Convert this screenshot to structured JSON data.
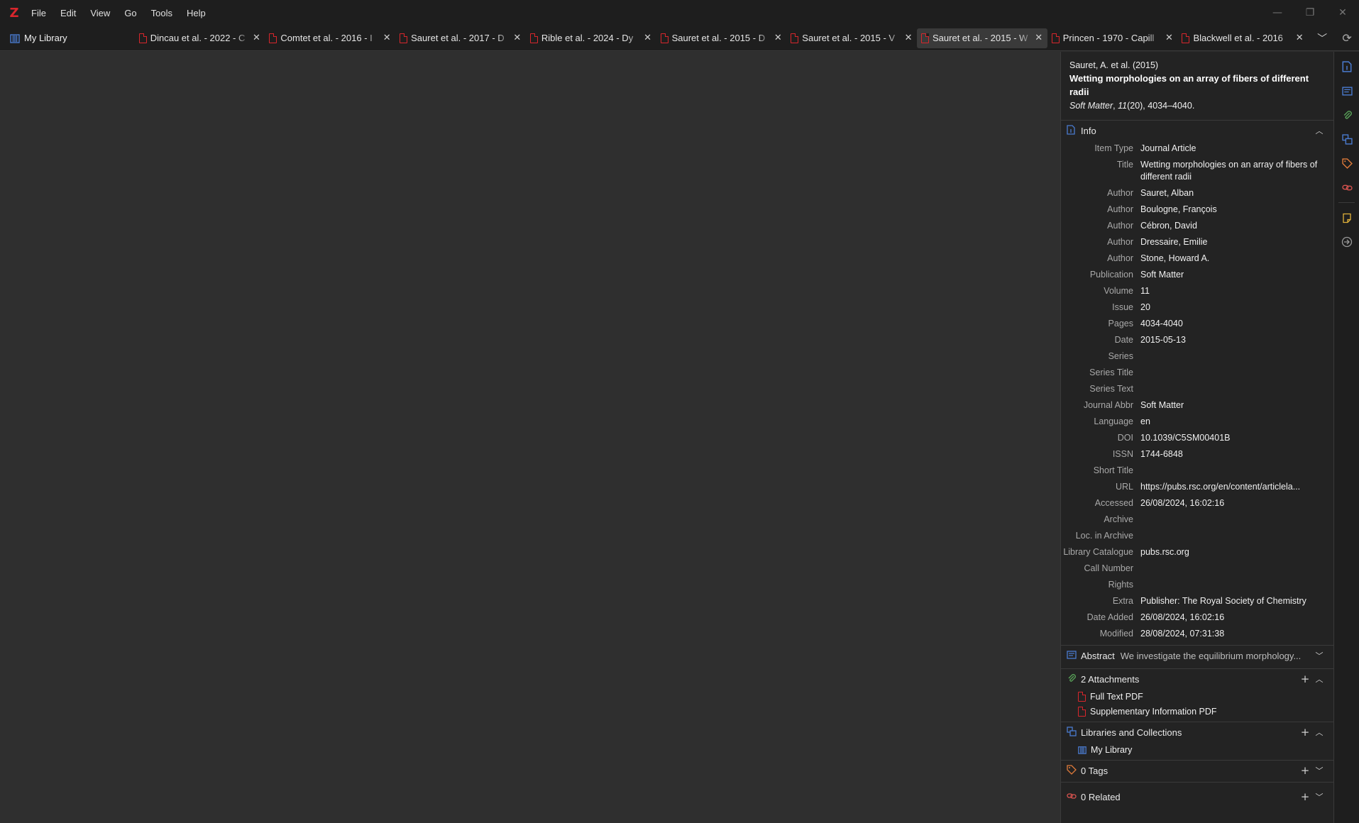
{
  "app": {
    "logo": "Z"
  },
  "menu": [
    "File",
    "Edit",
    "View",
    "Go",
    "Tools",
    "Help"
  ],
  "window_controls": {
    "minimize": "—",
    "restore": "❐",
    "close": "✕"
  },
  "library_tab": {
    "label": "My Library"
  },
  "tabs": [
    {
      "title": "Dincau et al. - 2022 - C"
    },
    {
      "title": "Comtet et al. - 2016 - I"
    },
    {
      "title": "Sauret et al. - 2017 - D"
    },
    {
      "title": "Rible et al. - 2024 - Dy"
    },
    {
      "title": "Sauret et al. - 2015 - D"
    },
    {
      "title": "Sauret et al. - 2015 - V"
    },
    {
      "title": "Sauret et al. - 2015 - W"
    },
    {
      "title": "Princen - 1970 - Capill"
    },
    {
      "title": "Blackwell et al. - 2016"
    }
  ],
  "header": {
    "cite": "Sauret, A. et al. (2015)",
    "title": "Wetting morphologies on an array of fibers of different radii",
    "journal_name": "Soft Matter",
    "journal_sep": ", ",
    "volume": "11",
    "issue_pages": "(20), 4034–4040."
  },
  "info": {
    "label": "Info",
    "fields": [
      {
        "label": "Item Type",
        "value": "Journal Article"
      },
      {
        "label": "Title",
        "value": "Wetting morphologies on an array of fibers of different radii"
      },
      {
        "label": "Author",
        "value": "Sauret, Alban"
      },
      {
        "label": "Author",
        "value": "Boulogne, François"
      },
      {
        "label": "Author",
        "value": "Cébron, David"
      },
      {
        "label": "Author",
        "value": "Dressaire, Emilie"
      },
      {
        "label": "Author",
        "value": "Stone, Howard A."
      },
      {
        "label": "Publication",
        "value": "Soft Matter"
      },
      {
        "label": "Volume",
        "value": "11"
      },
      {
        "label": "Issue",
        "value": "20"
      },
      {
        "label": "Pages",
        "value": "4034-4040"
      },
      {
        "label": "Date",
        "value": "2015-05-13"
      },
      {
        "label": "Series",
        "value": ""
      },
      {
        "label": "Series Title",
        "value": ""
      },
      {
        "label": "Series Text",
        "value": ""
      },
      {
        "label": "Journal Abbr",
        "value": "Soft Matter"
      },
      {
        "label": "Language",
        "value": "en"
      },
      {
        "label": "DOI",
        "value": "10.1039/C5SM00401B"
      },
      {
        "label": "ISSN",
        "value": "1744-6848"
      },
      {
        "label": "Short Title",
        "value": ""
      },
      {
        "label": "URL",
        "value": "https://pubs.rsc.org/en/content/articlela..."
      },
      {
        "label": "Accessed",
        "value": "26/08/2024, 16:02:16"
      },
      {
        "label": "Archive",
        "value": ""
      },
      {
        "label": "Loc. in Archive",
        "value": ""
      },
      {
        "label": "Library Catalogue",
        "value": "pubs.rsc.org"
      },
      {
        "label": "Call Number",
        "value": ""
      },
      {
        "label": "Rights",
        "value": ""
      },
      {
        "label": "Extra",
        "value": "Publisher: The Royal Society of Chemistry"
      },
      {
        "label": "Date Added",
        "value": "26/08/2024, 16:02:16"
      },
      {
        "label": "Modified",
        "value": "28/08/2024, 07:31:38"
      }
    ]
  },
  "abstract": {
    "label": "Abstract",
    "preview": "We investigate the equilibrium morphology..."
  },
  "attachments": {
    "label": "2 Attachments",
    "items": [
      "Full Text PDF",
      "Supplementary Information PDF"
    ]
  },
  "collections": {
    "label": "Libraries and Collections",
    "items": [
      "My Library"
    ]
  },
  "tags": {
    "label": "0 Tags"
  },
  "related": {
    "label": "0 Related"
  },
  "icons": {
    "add": "+",
    "collapse": "︿",
    "expand": "﹀",
    "tab_close": "✕",
    "overflow": "﹀",
    "sync": "⟳"
  },
  "colors": {
    "accent_red": "#d9262c",
    "info_blue": "#4a7bd0",
    "attachment_green": "#5aa55a",
    "tag_orange": "#e07b3a",
    "related_red": "#d9534f",
    "note_yellow": "#e0b13a"
  }
}
